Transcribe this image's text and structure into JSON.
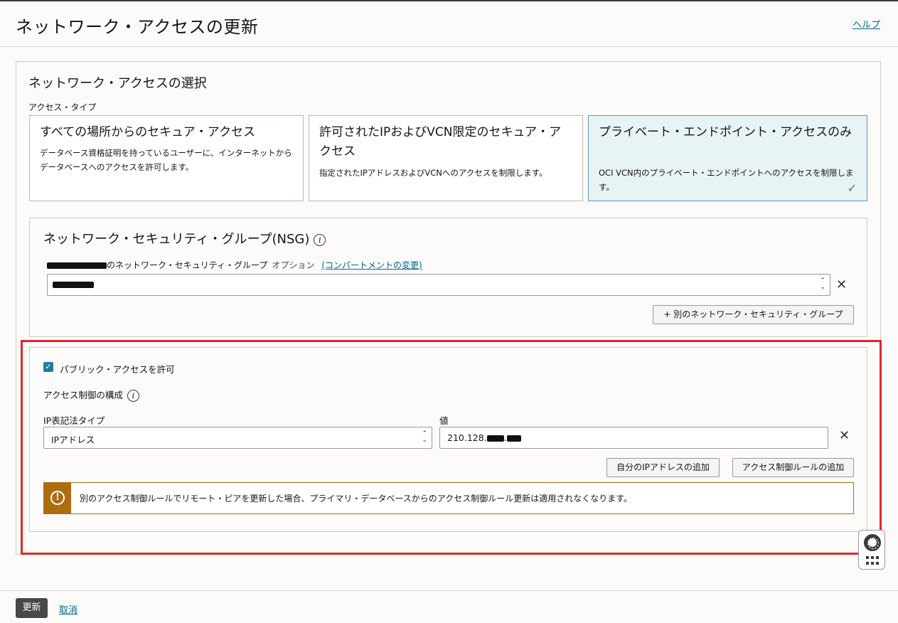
{
  "header": {
    "title": "ネットワーク・アクセスの更新",
    "help_link": "ヘルプ"
  },
  "access_selection": {
    "title": "ネットワーク・アクセスの選択",
    "access_type_label": "アクセス・タイプ",
    "cards": [
      {
        "title": "すべての場所からのセキュア・アクセス",
        "description": "データベース資格証明を持っているユーザーに、インターネットからデータベースへのアクセスを許可します。",
        "selected": false
      },
      {
        "title": "許可されたIPおよびVCN限定のセキュア・アクセス",
        "description": "指定されたIPアドレスおよびVCNへのアクセスを制限します。",
        "selected": false
      },
      {
        "title": "プライベート・エンドポイント・アクセスのみ",
        "description": "OCI VCN内のプライベート・エンドポイントへのアクセスを制限します。",
        "selected": true
      }
    ]
  },
  "nsg": {
    "title": "ネットワーク・セキュリティ・グループ(NSG)",
    "label_suffix": "のネットワーク・セキュリティ・グループ",
    "optional": "オプション",
    "change_compartment": "(コンパートメントの変更)",
    "add_button": "+ 別のネットワーク・セキュリティ・グループ"
  },
  "public_access": {
    "checkbox_label": "パブリック・アクセスを許可",
    "checked": true,
    "acl_label": "アクセス制御の構成",
    "ip_notation_label": "IP表記法タイプ",
    "ip_notation_value": "IPアドレス",
    "value_label": "値",
    "value_prefix": "210.128.",
    "add_my_ip_button": "自分のIPアドレスの追加",
    "add_rule_button": "アクセス制御ルールの追加",
    "warning_text": "別のアクセス制御ルールでリモート・ピアを更新した場合、プライマリ・データベースからのアクセス制御ルール更新は適用されなくなります。"
  },
  "footer": {
    "update_button": "更新",
    "cancel_link": "取消"
  },
  "colors": {
    "accent": "#227e9e",
    "link": "#00688c",
    "warning": "#ae6c10",
    "highlight_border": "#e0262e",
    "selected_card_bg": "#e8f3f6"
  }
}
